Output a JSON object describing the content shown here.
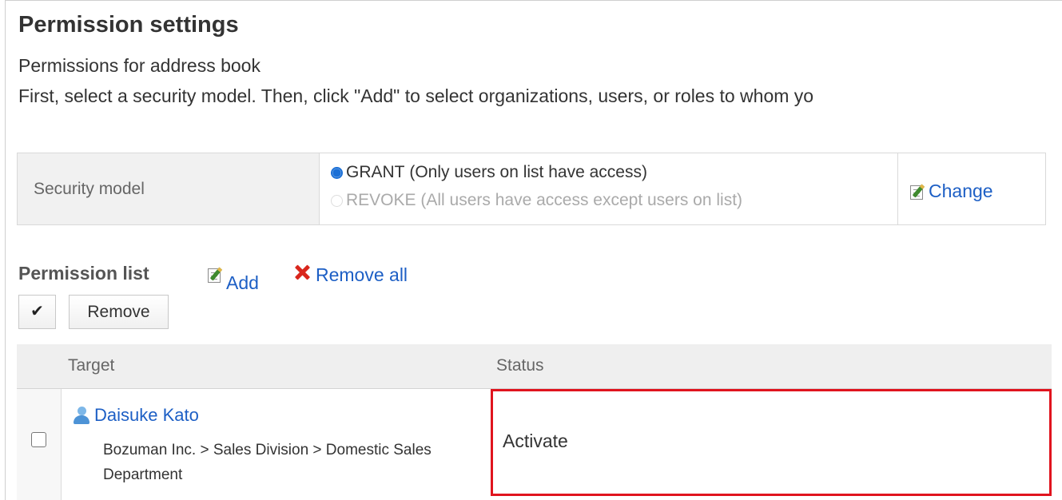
{
  "header": {
    "title": "Permission settings",
    "subtitle": "Permissions for address book",
    "instruction": "First, select a security model. Then, click \"Add\" to select organizations, users, or roles to whom yo"
  },
  "security_model": {
    "label": "Security model",
    "options": [
      {
        "label": "GRANT (Only users on list have access)",
        "selected": true,
        "enabled": true
      },
      {
        "label": "REVOKE (All users have access except users on list)",
        "selected": false,
        "enabled": false
      }
    ],
    "change_label": "Change"
  },
  "permission_list": {
    "title": "Permission list",
    "add_label": "Add",
    "remove_all_label": "Remove all",
    "check_all_glyph": "✔",
    "remove_label": "Remove",
    "columns": [
      "Target",
      "Status"
    ],
    "rows": [
      {
        "name": "Daisuke Kato",
        "path": "Bozuman Inc. > Sales Division > Domestic Sales Department",
        "status": "Activate",
        "checked": false
      }
    ]
  },
  "colors": {
    "link": "#1d5fc5",
    "highlight_border": "#e0141e",
    "radio_selected": "#1a6fd6",
    "delete_icon": "#d9261c"
  },
  "icons": {
    "change": "edit-memo-icon",
    "add": "edit-memo-icon",
    "remove_all": "red-x-icon",
    "user": "user-icon"
  }
}
